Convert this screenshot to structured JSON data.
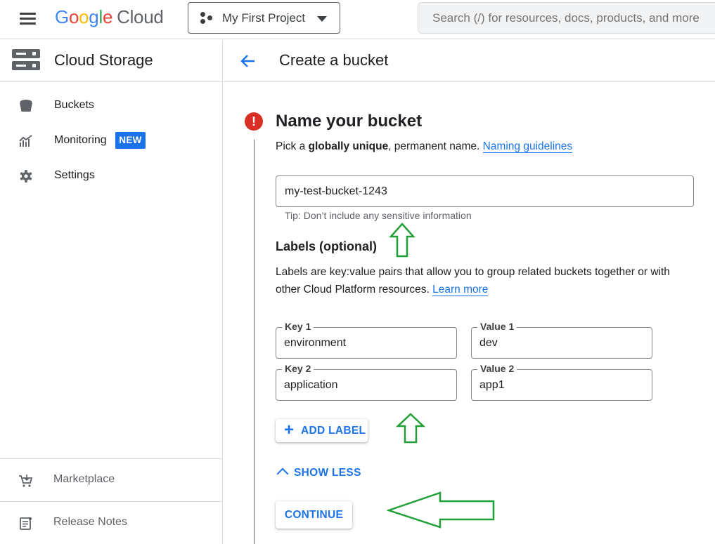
{
  "header": {
    "logo_google": [
      "G",
      "o",
      "o",
      "g",
      "l",
      "e"
    ],
    "logo_cloud": "Cloud",
    "project_name": "My First Project",
    "search_placeholder": "Search (/) for resources, docs, products, and more"
  },
  "sidebar": {
    "title": "Cloud Storage",
    "items": [
      {
        "label": "Buckets",
        "icon": "bucket-icon"
      },
      {
        "label": "Monitoring",
        "icon": "monitoring-icon",
        "badge": "NEW"
      },
      {
        "label": "Settings",
        "icon": "gear-icon"
      }
    ],
    "bottom_items": [
      {
        "label": "Marketplace",
        "icon": "marketplace-cart-icon"
      },
      {
        "label": "Release Notes",
        "icon": "release-notes-icon"
      }
    ]
  },
  "main": {
    "title": "Create a bucket",
    "section": {
      "title": "Name your bucket",
      "desc_prefix": "Pick a ",
      "desc_bold": "globally unique",
      "desc_suffix": ", permanent name.",
      "desc_link": "Naming guidelines",
      "bucket_name": "my-test-bucket-1243",
      "tip": "Tip: Don’t include any sensitive information"
    },
    "labels": {
      "title": "Labels (optional)",
      "desc": "Labels are key:value pairs that allow you to group related buckets together or with other Cloud Platform resources.",
      "desc_link": "Learn more",
      "rows": [
        {
          "key_label": "Key 1",
          "key": "environment",
          "value_label": "Value 1",
          "value": "dev"
        },
        {
          "key_label": "Key 2",
          "key": "application",
          "value_label": "Value 2",
          "value": "app1"
        }
      ],
      "add_label": "ADD LABEL",
      "show_less": "SHOW LESS"
    },
    "continue_label": "CONTINUE"
  },
  "colors": {
    "accent": "#1a73e8",
    "error": "#d93025",
    "annotation": "#21a038"
  }
}
